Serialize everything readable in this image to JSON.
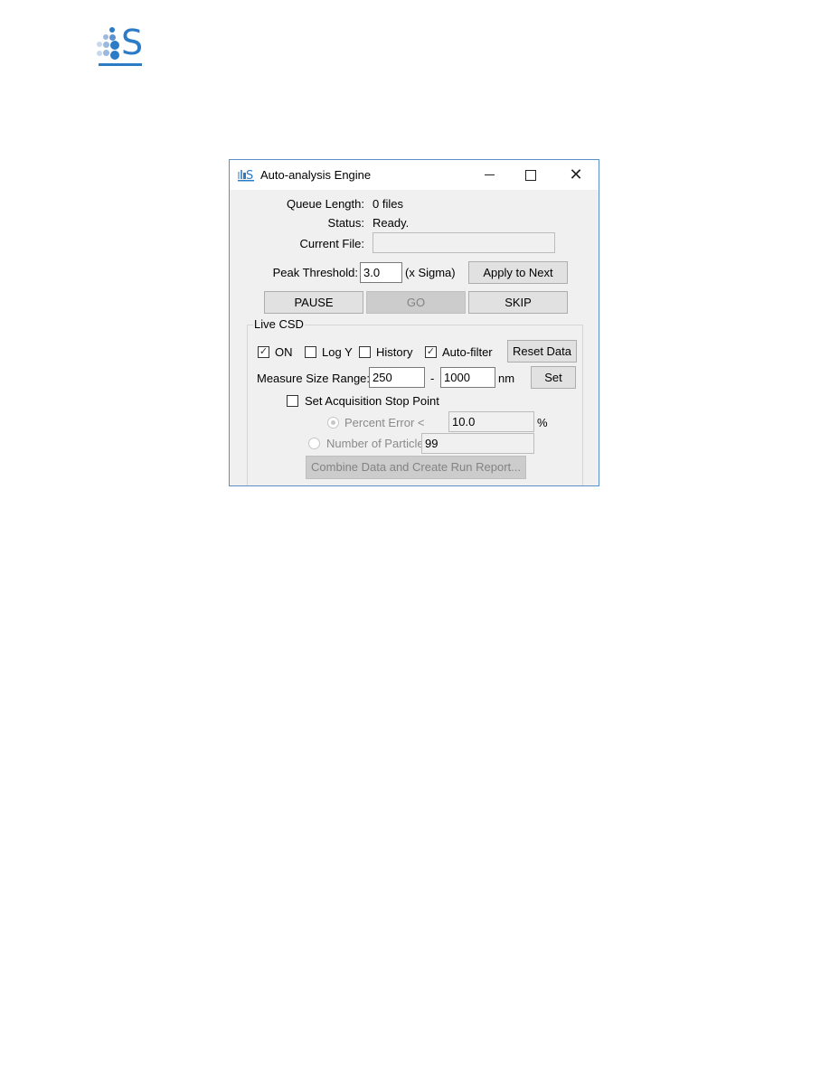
{
  "page": {
    "logo_letter": "S",
    "logo_color": "#2b7bc7"
  },
  "window": {
    "title": "Auto-analysis Engine",
    "icon": "app-logo-icon",
    "controls": {
      "minimize": "minimize-icon",
      "maximize": "maximize-icon",
      "close": "close-icon",
      "close_glyph": "✕"
    }
  },
  "status": {
    "queue_length_label": "Queue Length:",
    "queue_length_value": "0 files",
    "status_label": "Status:",
    "status_value": "Ready.",
    "current_file_label": "Current File:",
    "current_file_value": ""
  },
  "threshold": {
    "label": "Peak Threshold:",
    "value": "3.0",
    "unit": "(x Sigma)",
    "apply_button": "Apply to Next"
  },
  "actions": {
    "pause": "PAUSE",
    "go": "GO",
    "skip": "SKIP"
  },
  "live_csd": {
    "title": "Live CSD",
    "checkboxes": [
      {
        "label": "ON",
        "checked": true
      },
      {
        "label": "Log Y",
        "checked": false
      },
      {
        "label": "History",
        "checked": false
      },
      {
        "label": "Auto-filter",
        "checked": true
      }
    ],
    "check_glyph": "✓",
    "reset_button": "Reset Data",
    "size_range_label": "Measure Size Range:",
    "size_min": "250",
    "size_separator": "-",
    "size_max": "1000",
    "size_unit": "nm",
    "set_button": "Set",
    "stop_point_label": "Set Acquisition Stop Point",
    "stop_point_checked": false,
    "percent_error_label": "Percent Error <",
    "percent_error_value": "10.0",
    "percent_unit": "%",
    "particles_label": "Number of Particles >",
    "particles_value": "99",
    "combine_button": "Combine Data and Create Run Report..."
  }
}
